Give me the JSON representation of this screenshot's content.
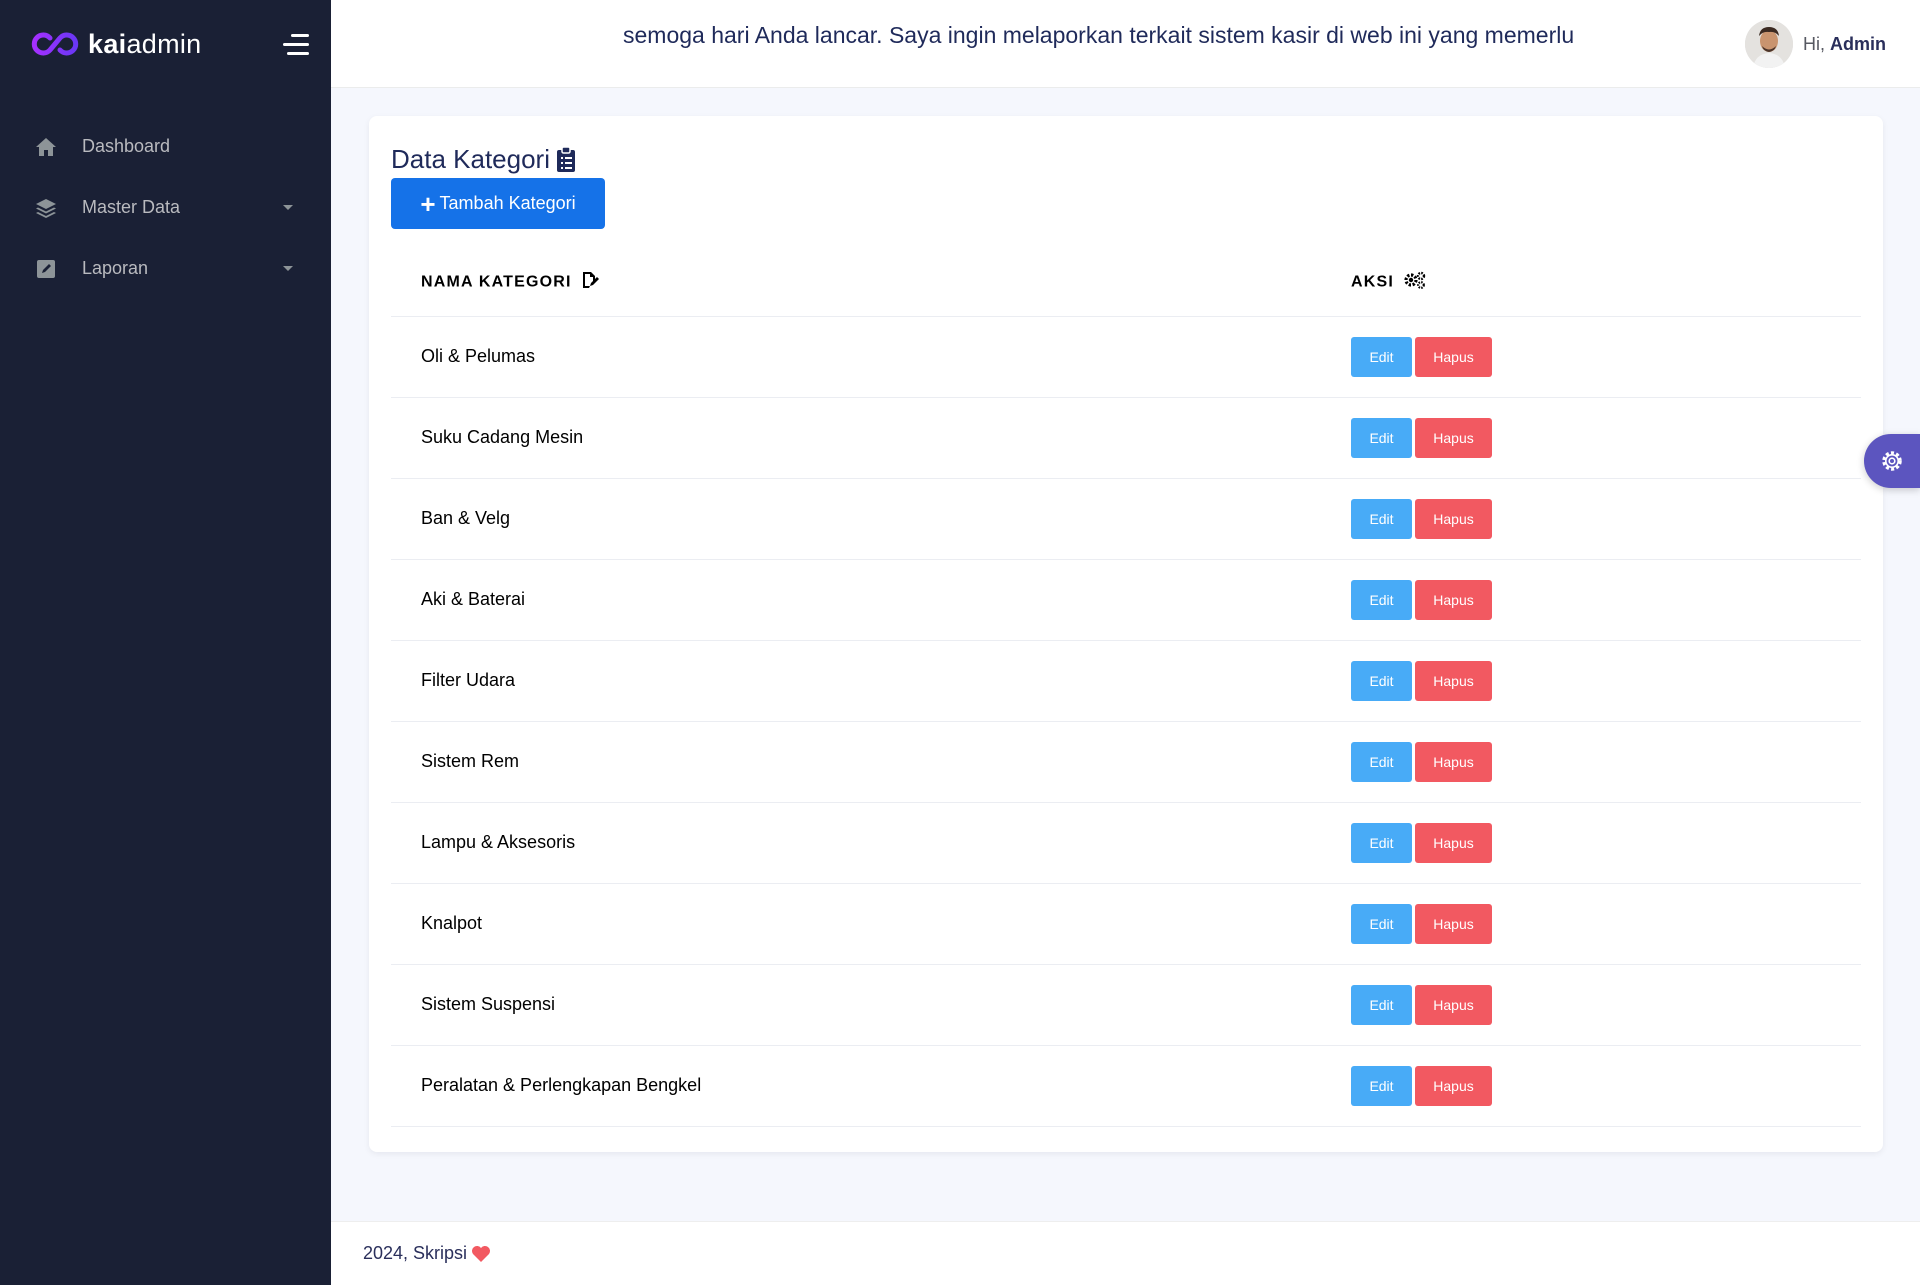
{
  "brand": {
    "name_bold": "kai",
    "name_light": "admin"
  },
  "sidebar": {
    "items": [
      {
        "label": "Dashboard",
        "icon": "home-icon",
        "has_caret": false
      },
      {
        "label": "Master Data",
        "icon": "layers-icon",
        "has_caret": true
      },
      {
        "label": "Laporan",
        "icon": "edit-square-icon",
        "has_caret": true
      }
    ]
  },
  "header": {
    "marquee": "semoga hari Anda lancar. Saya ingin melaporkan terkait sistem kasir di web ini yang memerlu",
    "greeting": "Hi,",
    "username": "Admin"
  },
  "card": {
    "title": "Data Kategori",
    "add_button": "Tambah Kategori",
    "columns": [
      "NAMA KATEGORI",
      "AKSI"
    ],
    "rows": [
      "Oli & Pelumas",
      "Suku Cadang Mesin",
      "Ban & Velg",
      "Aki & Baterai",
      "Filter Udara",
      "Sistem Rem",
      "Lampu & Aksesoris",
      "Knalpot",
      "Sistem Suspensi",
      "Peralatan & Perlengkapan Bengkel"
    ],
    "edit_label": "Edit",
    "delete_label": "Hapus"
  },
  "footer": {
    "text": "2024, Skripsi"
  },
  "colors": {
    "sidebar_bg": "#1a2035",
    "primary": "#1572e8",
    "info": "#48abf7",
    "danger": "#f25961",
    "settings": "#5c55bf"
  }
}
